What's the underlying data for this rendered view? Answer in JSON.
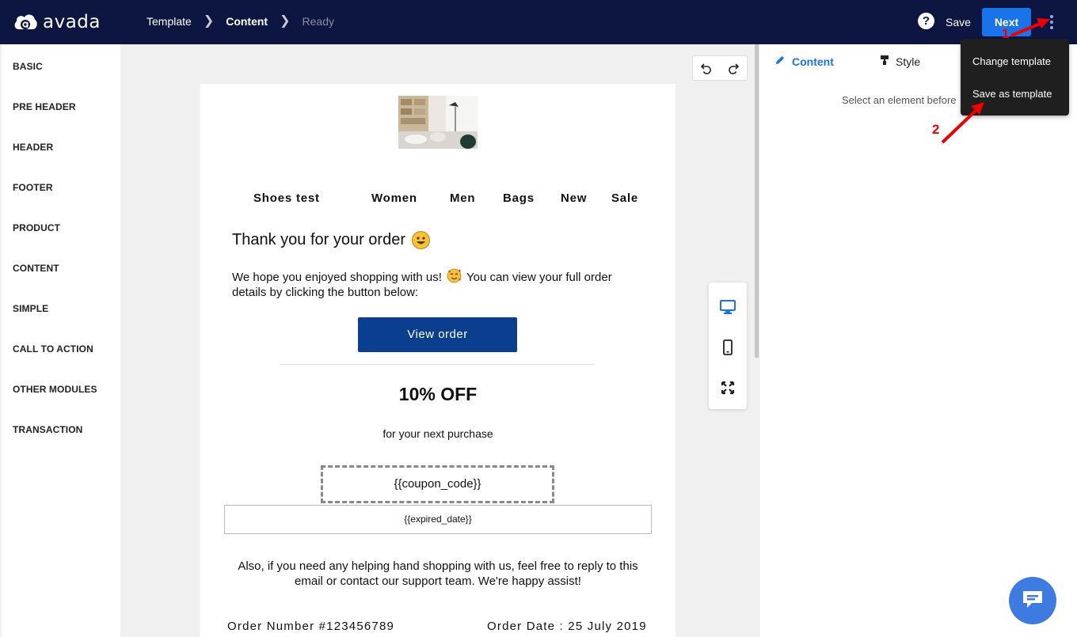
{
  "app": {
    "logo_text": "avada"
  },
  "breadcrumb": [
    {
      "label": "Template",
      "state": "done"
    },
    {
      "label": "Content",
      "state": "active"
    },
    {
      "label": "Ready",
      "state": "pending"
    }
  ],
  "header": {
    "help_label": "?",
    "save_label": "Save",
    "next_label": "Next"
  },
  "sidebar": {
    "items": [
      {
        "label": "BASIC"
      },
      {
        "label": "PRE HEADER"
      },
      {
        "label": "HEADER"
      },
      {
        "label": "FOOTER"
      },
      {
        "label": "PRODUCT"
      },
      {
        "label": "CONTENT"
      },
      {
        "label": "SIMPLE"
      },
      {
        "label": "CALL TO ACTION"
      },
      {
        "label": "OTHER MODULES"
      },
      {
        "label": "TRANSACTION"
      }
    ]
  },
  "email": {
    "nav": [
      "Shoes test",
      "Women",
      "Men",
      "Bags",
      "New",
      "Sale"
    ],
    "thank_you": "Thank you for your order",
    "body_pre": "We hope you enjoyed shopping with us!",
    "body_post": "You can view your full order details by clicking the button below:",
    "view_order": "View order",
    "discount": "10% OFF",
    "next_purchase": "for your next purchase",
    "coupon": "{{coupon_code}}",
    "expired": "{{expired_date}}",
    "also": "Also, if you need any helping hand shopping with us, feel free to reply to this email or contact our support team. We're happy assist!",
    "order_number": "Order Number #123456789",
    "order_date": "Order Date : 25 July 2019"
  },
  "right_panel": {
    "tab_content": "Content",
    "tab_style": "Style",
    "hint": "Select an element before"
  },
  "dropdown": {
    "items": [
      "Change template",
      "Save as template"
    ]
  },
  "annotations": {
    "step1": "1",
    "step2": "2"
  },
  "colors": {
    "topbar": "#0d1640",
    "accent": "#1a73e8",
    "button": "#0a3f8f",
    "annotation": "#e00000"
  }
}
